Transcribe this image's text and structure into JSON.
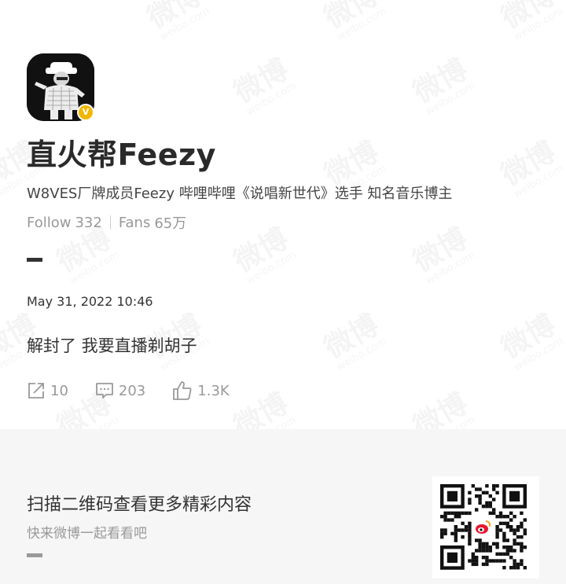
{
  "watermark": {
    "big": "微博",
    "small": "weibo.com"
  },
  "profile": {
    "avatar_icon": "avatar-illustration-icon",
    "verified_icon": "verified-badge-icon",
    "verified_mark": "V",
    "name": "直火帮Feezy",
    "bio": "W8VES厂牌成员Feezy  哔哩哔哩《说唱新世代》选手 知名音乐博主",
    "follow_label": "Follow",
    "follow_count": "332",
    "fans_label": "Fans",
    "fans_count": "65万"
  },
  "post": {
    "date": "May 31, 2022 10:46",
    "text": "解封了 我要直播剃胡子"
  },
  "actions": {
    "repost_icon": "share-icon",
    "repost_count": "10",
    "comment_icon": "comment-icon",
    "comment_count": "203",
    "like_icon": "thumbs-up-icon",
    "like_count": "1.3K"
  },
  "footer": {
    "title": "扫描二维码查看更多精彩内容",
    "subtitle": "快来微博一起看看吧",
    "qr_icon": "qr-code-icon"
  },
  "colors": {
    "verified": "#f2b705",
    "footer_bg": "#f6f6f6",
    "muted_text": "#999999",
    "primary_text": "#333333"
  }
}
